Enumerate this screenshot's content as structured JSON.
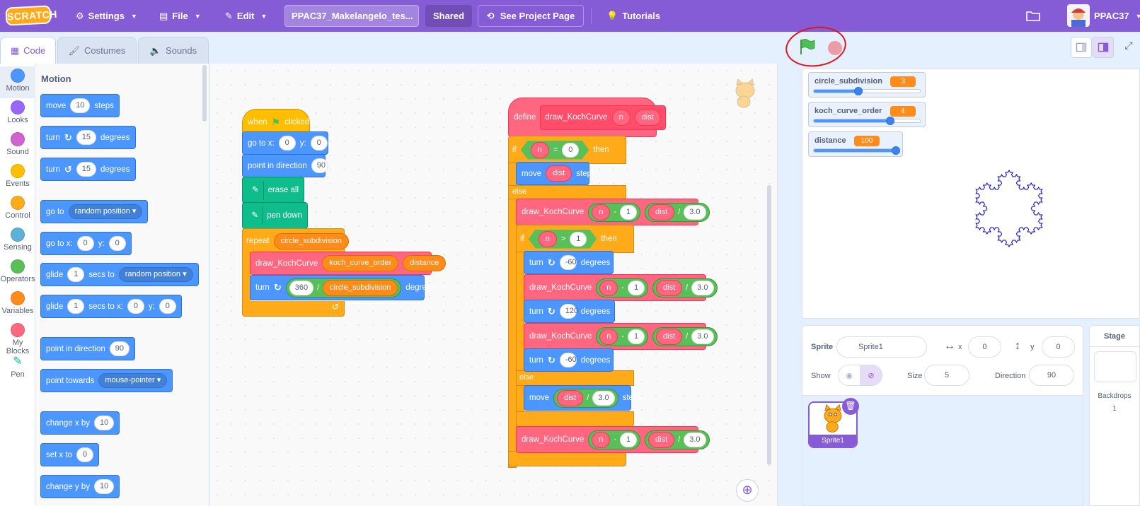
{
  "menubar": {
    "logo": "SCRATCH",
    "settings": "Settings",
    "file": "File",
    "edit": "Edit",
    "project_title": "PPAC37_Makelangelo_tes...",
    "shared": "Shared",
    "see_project_page": "See Project Page",
    "tutorials": "Tutorials",
    "username": "PPAC37"
  },
  "tabs": [
    {
      "label": "Code",
      "active": true
    },
    {
      "label": "Costumes",
      "active": false
    },
    {
      "label": "Sounds",
      "active": false
    }
  ],
  "categories": [
    {
      "label": "Motion",
      "color": "#4c97ff"
    },
    {
      "label": "Looks",
      "color": "#9966ff"
    },
    {
      "label": "Sound",
      "color": "#cf63cf"
    },
    {
      "label": "Events",
      "color": "#ffbf00"
    },
    {
      "label": "Control",
      "color": "#ffab19"
    },
    {
      "label": "Sensing",
      "color": "#5cb1d6"
    },
    {
      "label": "Operators",
      "color": "#59c059"
    },
    {
      "label": "Variables",
      "color": "#ff8c1a"
    },
    {
      "label": "My Blocks",
      "color": "#ff6680"
    },
    {
      "label": "Pen",
      "color": "#0fbd8c"
    }
  ],
  "palette": {
    "title": "Motion",
    "move": {
      "pre": "move",
      "val": "10",
      "post": "steps"
    },
    "turn_right": {
      "pre": "turn",
      "val": "15",
      "post": "degrees"
    },
    "turn_left": {
      "pre": "turn",
      "val": "15",
      "post": "degrees"
    },
    "goto": {
      "pre": "go to",
      "drop": "random position"
    },
    "goto_xy": {
      "pre": "go to x:",
      "x": "0",
      "ylabel": "y:",
      "y": "0"
    },
    "glide": {
      "pre": "glide",
      "val": "1",
      "mid": "secs to",
      "drop": "random position"
    },
    "glide_xy": {
      "pre": "glide",
      "val": "1",
      "mid": "secs to x:",
      "x": "0",
      "ylabel": "y:",
      "y": "0"
    },
    "point_dir": {
      "pre": "point in direction",
      "val": "90"
    },
    "point_towards": {
      "pre": "point towards",
      "drop": "mouse-pointer"
    },
    "change_x": {
      "pre": "change x by",
      "val": "10"
    },
    "set_x": {
      "pre": "set x to",
      "val": "0"
    },
    "change_y": {
      "pre": "change y by",
      "val": "10"
    }
  },
  "script1": {
    "hat": {
      "pre": "when",
      "post": "clicked"
    },
    "goto": {
      "pre": "go to x:",
      "x": "0",
      "ylabel": "y:",
      "y": "0"
    },
    "point": {
      "pre": "point in direction",
      "val": "90"
    },
    "erase": "erase all",
    "pendown": "pen down",
    "repeat": {
      "label": "repeat",
      "var": "circle_subdivision"
    },
    "call": {
      "name": "draw_KochCurve",
      "a1": "koch_curve_order",
      "a2": "distance"
    },
    "turn": {
      "pre": "turn",
      "a": "360",
      "op": "/",
      "b": "circle_subdivision",
      "post": "degrees"
    }
  },
  "script2": {
    "define": {
      "label": "define",
      "name": "draw_KochCurve",
      "p1": "n",
      "p2": "dist"
    },
    "if1": {
      "label": "if",
      "left": "n",
      "op": "=",
      "right": "0",
      "then": "then"
    },
    "move1": {
      "pre": "move",
      "arg": "dist",
      "post": "steps"
    },
    "else1": "else",
    "call_a": {
      "name": "draw_KochCurve",
      "n": "n",
      "minus": "-",
      "one": "1",
      "dist": "dist",
      "div": "/",
      "three": "3.0"
    },
    "if2": {
      "label": "if",
      "left": "n",
      "op": ">",
      "right": "1",
      "then": "then"
    },
    "turn1": {
      "pre": "turn",
      "val": "-60",
      "post": "degrees"
    },
    "call_b": {
      "name": "draw_KochCurve",
      "n": "n",
      "minus": "-",
      "one": "1",
      "dist": "dist",
      "div": "/",
      "three": "3.0"
    },
    "turn2": {
      "pre": "turn",
      "val": "120",
      "post": "degrees"
    },
    "call_c": {
      "name": "draw_KochCurve",
      "n": "n",
      "minus": "-",
      "one": "1",
      "dist": "dist",
      "div": "/",
      "three": "3.0"
    },
    "turn3": {
      "pre": "turn",
      "val": "-60",
      "post": "degrees"
    },
    "else2": "else",
    "move2": {
      "pre": "move",
      "arg": "dist",
      "div": "/",
      "three": "3.0",
      "post": "steps"
    },
    "call_d": {
      "name": "draw_KochCurve",
      "n": "n",
      "minus": "-",
      "one": "1",
      "dist": "dist",
      "div": "/",
      "three": "3.0"
    }
  },
  "monitors": [
    {
      "label": "circle_subdivision",
      "value": "3",
      "fraction": 0.42
    },
    {
      "label": "koch_curve_order",
      "value": "4",
      "fraction": 0.72
    },
    {
      "label": "distance",
      "value": "100",
      "fraction": 0.98
    }
  ],
  "sprite_info": {
    "sprite_label": "Sprite",
    "sprite_name": "Sprite1",
    "x_label": "x",
    "x": "0",
    "y_label": "y",
    "y": "0",
    "show_label": "Show",
    "size_label": "Size",
    "size": "5",
    "direction_label": "Direction",
    "direction": "90"
  },
  "sprites": [
    {
      "name": "Sprite1"
    }
  ],
  "stage_panel": {
    "title": "Stage",
    "backdrops_label": "Backdrops",
    "backdrops_count": "1"
  }
}
